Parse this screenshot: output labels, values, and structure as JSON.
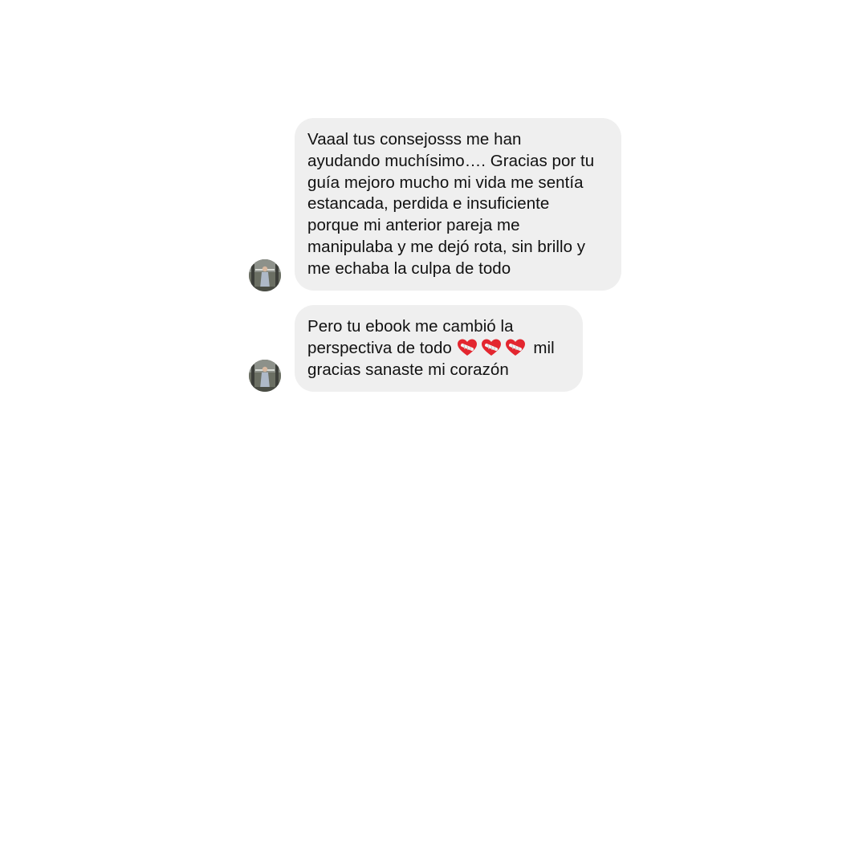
{
  "conversation": {
    "messages": [
      {
        "sender": "other",
        "lines": [
          "Vaaal tus consejosss me han",
          "ayudando muchísimo…. Gracias por tu",
          "guía mejoro mucho mi vida me sentía",
          "estancada, perdida e insuficiente",
          "porque mi anterior pareja me",
          "manipulaba y me dejó rota, sin brillo y",
          "me echaba la culpa de todo"
        ]
      },
      {
        "sender": "other",
        "line1": "Pero tu ebook me cambió la",
        "line2_start": "perspectiva de todo",
        "emoji": [
          "mending-heart",
          "mending-heart",
          "mending-heart"
        ],
        "line2_end": "mil",
        "line3": "gracias sanaste mi corazón"
      }
    ]
  },
  "colors": {
    "background": "#ffffff",
    "bubble": "#efefef",
    "text": "#111111",
    "heart": "#e3262f"
  }
}
